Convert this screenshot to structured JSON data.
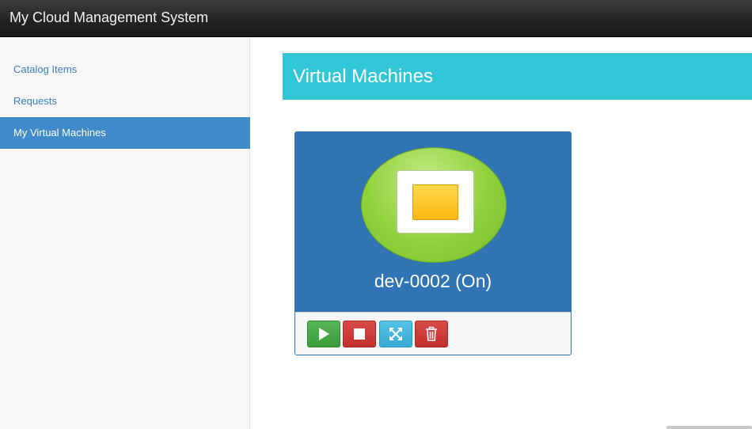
{
  "app": {
    "title": "My Cloud Management System"
  },
  "sidebar": {
    "items": [
      {
        "label": "Catalog Items",
        "active": false
      },
      {
        "label": "Requests",
        "active": false
      },
      {
        "label": "My Virtual Machines",
        "active": true
      }
    ]
  },
  "main": {
    "title": "Virtual Machines",
    "vm": {
      "name": "dev-0002 (On)",
      "icon": "vm-monitor-icon",
      "actions": [
        {
          "icon": "play-icon",
          "color": "#4cae4c"
        },
        {
          "icon": "stop-icon",
          "color": "#d43f3a"
        },
        {
          "icon": "fullscreen-icon",
          "color": "#46b8da"
        },
        {
          "icon": "trash-icon",
          "color": "#d43f3a"
        }
      ]
    }
  },
  "colors": {
    "topbar": "#222222",
    "active_nav": "#428bca",
    "header": "#31c6d6",
    "card": "#3174b3"
  }
}
